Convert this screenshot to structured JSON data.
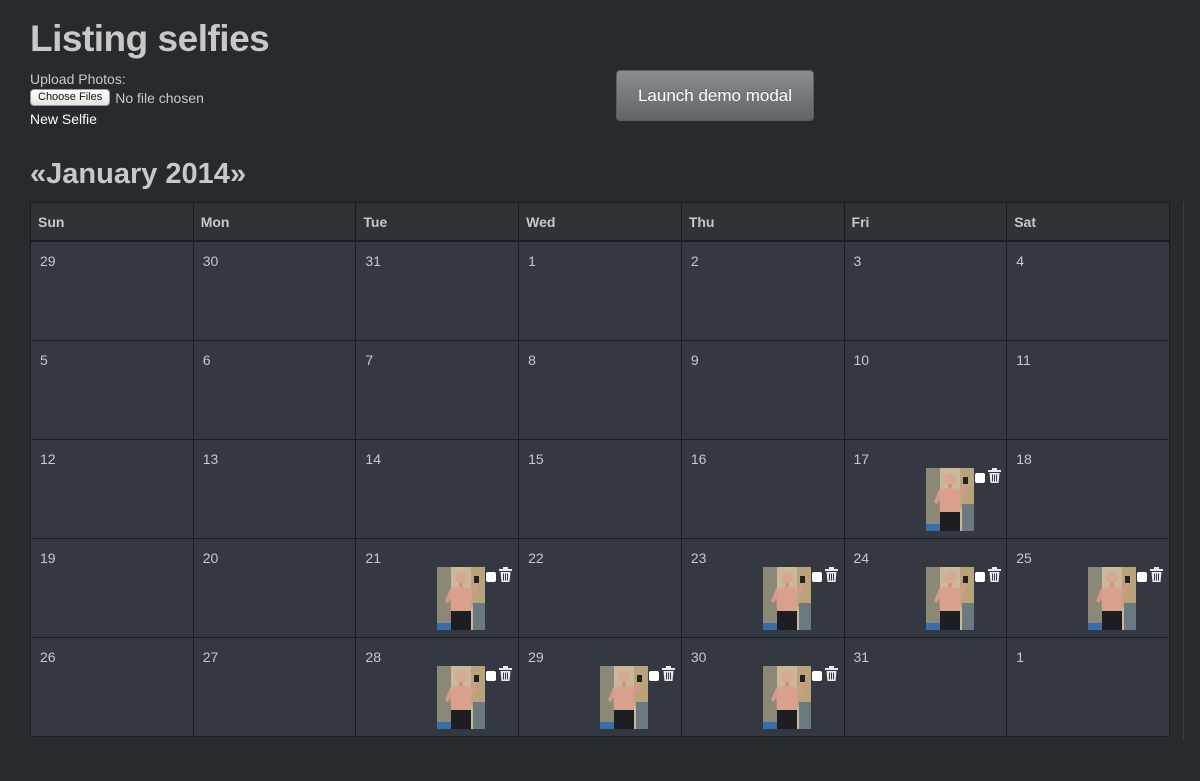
{
  "page": {
    "title": "Listing selfies",
    "upload_label": "Upload Photos:",
    "choose_files_label": "Choose Files",
    "file_status": "No file chosen",
    "new_selfie_label": "New Selfie",
    "modal_button_label": "Launch demo modal"
  },
  "calendar": {
    "prev_label": "«",
    "month_label": "January 2014",
    "next_label": "»",
    "weekdays": [
      "Sun",
      "Mon",
      "Tue",
      "Wed",
      "Thu",
      "Fri",
      "Sat"
    ],
    "weeks": [
      [
        {
          "day": "29"
        },
        {
          "day": "30"
        },
        {
          "day": "31"
        },
        {
          "day": "1"
        },
        {
          "day": "2"
        },
        {
          "day": "3"
        },
        {
          "day": "4"
        }
      ],
      [
        {
          "day": "5"
        },
        {
          "day": "6"
        },
        {
          "day": "7"
        },
        {
          "day": "8"
        },
        {
          "day": "9"
        },
        {
          "day": "10"
        },
        {
          "day": "11"
        }
      ],
      [
        {
          "day": "12"
        },
        {
          "day": "13"
        },
        {
          "day": "14"
        },
        {
          "day": "15"
        },
        {
          "day": "16"
        },
        {
          "day": "17",
          "selfie": true
        },
        {
          "day": "18"
        }
      ],
      [
        {
          "day": "19"
        },
        {
          "day": "20"
        },
        {
          "day": "21",
          "selfie": true
        },
        {
          "day": "22"
        },
        {
          "day": "23",
          "selfie": true
        },
        {
          "day": "24",
          "selfie": true
        },
        {
          "day": "25",
          "selfie": true
        }
      ],
      [
        {
          "day": "26"
        },
        {
          "day": "27"
        },
        {
          "day": "28",
          "selfie": true
        },
        {
          "day": "29",
          "selfie": true
        },
        {
          "day": "30",
          "selfie": true
        },
        {
          "day": "31"
        },
        {
          "day": "1"
        }
      ]
    ]
  },
  "colors": {
    "background": "#272b30",
    "cell": "#343840",
    "header_cell": "#2e3338",
    "border": "#1a1c1f",
    "text": "#c8c8c8",
    "button": "#7a7e82"
  },
  "icons": {
    "trash": "trash-icon",
    "checkbox": "checkbox-icon",
    "photo": "selfie-photo"
  }
}
